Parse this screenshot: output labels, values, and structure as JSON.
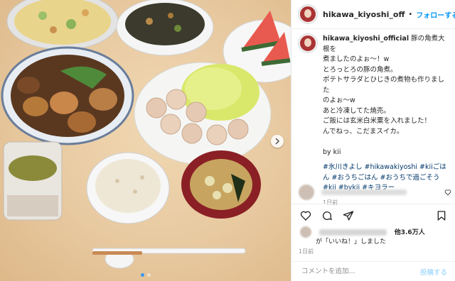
{
  "post": {
    "username": "hikawa_kiyoshi_off",
    "separator": "•",
    "follow_label": "フォローする"
  },
  "caption": {
    "username": "hikawa_kiyoshi_official",
    "lines": [
      "豚の角煮大根を",
      "煮ましたのよぉ～！w",
      "とろっとろの豚の角煮。",
      "ポテトサラダとひじきの煮物も作りました",
      "のよぉ～w",
      "あと冷凍してた焼売。",
      "ご飯には玄米白米粟を入れました！",
      "んでねっ、こだまスイカ。",
      "",
      "by kii"
    ],
    "hashtags": "#氷川きよし #hikawakiyoshi #kiiごはん #おうちごはん #おうちで過ごそう #kii #bykii #キヨラー",
    "time": "1日前"
  },
  "likes": {
    "count_text": "他3.6万人",
    "suffix": "が「いいね！」しました"
  },
  "time2": "1日前",
  "comment": {
    "placeholder": "コメントを追加...",
    "post_label": "投稿する"
  },
  "icons": {
    "like": "heart-icon",
    "comment": "comment-icon",
    "share": "paper-plane-icon",
    "save": "bookmark-icon",
    "next": "chevron-right-icon"
  },
  "colors": {
    "accent": "#0095f6",
    "text": "#262626",
    "muted": "#8e8e8e",
    "hashtag": "#00376b",
    "post_disabled": "#b2dffc"
  }
}
